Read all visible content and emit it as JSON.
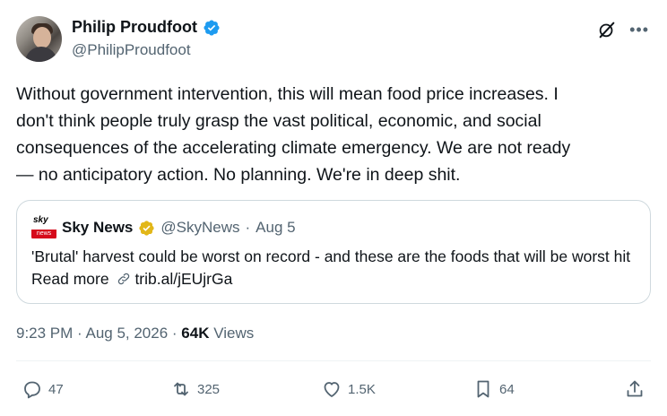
{
  "author": {
    "display_name": "Philip Proudfoot",
    "handle": "@PhilipProudfoot"
  },
  "tweet": {
    "text": "Without government intervention, this will mean food price increases. I\ndon't think people truly grasp the vast political, economic, and social\nconsequences of the accelerating climate emergency. We are not ready\n— no anticipatory action. No planning. We're in deep shit."
  },
  "quoted": {
    "logo_top": "sky",
    "logo_bottom": "news",
    "name": "Sky News",
    "handle": "@SkyNews",
    "separator": "·",
    "date": "Aug 5",
    "text_main": "'Brutal' harvest could be worst on record - and these are the foods that will be worst hit  Read more ",
    "link": "trib.al/jEUjrGa"
  },
  "meta": {
    "time": "9:23 PM",
    "sep1": " · ",
    "date": "Aug 5, 2026",
    "sep2": " · ",
    "views_count": "64K",
    "views_label": " Views"
  },
  "actions": {
    "replies": "47",
    "reposts": "325",
    "likes": "1.5K",
    "bookmarks": "64"
  },
  "icons": {
    "verified": "verified-badge-icon",
    "gold_verified": "gold-verified-badge-icon",
    "grok": "grok-icon",
    "more": "more-icon",
    "reply": "reply-icon",
    "repost": "repost-icon",
    "like": "heart-icon",
    "bookmark": "bookmark-icon",
    "share": "share-icon",
    "link": "link-icon"
  },
  "colors": {
    "verified_blue": "#1d9bf0",
    "gold": "#e2b719",
    "secondary_text": "#536471",
    "sky_red": "#d60a1b"
  }
}
